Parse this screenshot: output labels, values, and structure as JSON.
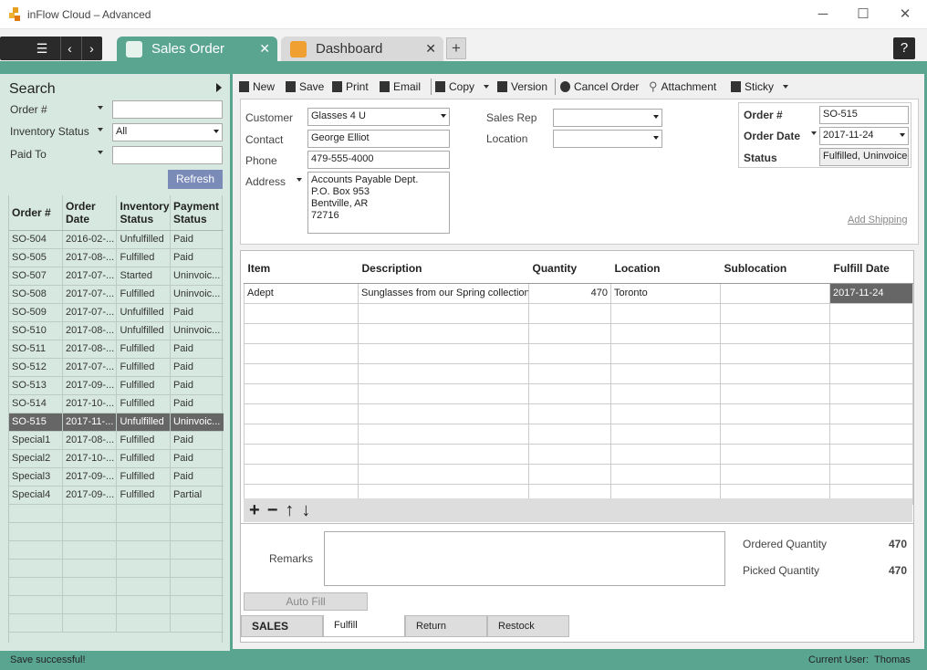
{
  "window": {
    "title": "inFlow Cloud – Advanced",
    "minimize": "─",
    "maximize": "☐",
    "close": "✕"
  },
  "nav": {
    "menu": "☰",
    "back": "‹",
    "forward": "›",
    "help": "?"
  },
  "tabs": [
    {
      "label": "Sales Order",
      "close": "✕",
      "icon": "sales-order-icon"
    },
    {
      "label": "Dashboard",
      "close": "✕",
      "icon": "dashboard-icon"
    }
  ],
  "tab_add": "+",
  "search": {
    "title": "Search",
    "fields": [
      {
        "label": "Order #",
        "value": ""
      },
      {
        "label": "Inventory Status",
        "value": "All"
      },
      {
        "label": "Paid To",
        "value": ""
      }
    ],
    "refresh": "Refresh",
    "columns": [
      "Order #",
      "Order Date",
      "Inventory Status",
      "Payment Status"
    ],
    "rows": [
      [
        "SO-504",
        "2016-02-...",
        "Unfulfilled",
        "Paid"
      ],
      [
        "SO-505",
        "2017-08-...",
        "Fulfilled",
        "Paid"
      ],
      [
        "SO-507",
        "2017-07-...",
        "Started",
        "Uninvoic..."
      ],
      [
        "SO-508",
        "2017-07-...",
        "Fulfilled",
        "Uninvoic..."
      ],
      [
        "SO-509",
        "2017-07-...",
        "Unfulfilled",
        "Paid"
      ],
      [
        "SO-510",
        "2017-08-...",
        "Unfulfilled",
        "Uninvoic..."
      ],
      [
        "SO-511",
        "2017-08-...",
        "Fulfilled",
        "Paid"
      ],
      [
        "SO-512",
        "2017-07-...",
        "Fulfilled",
        "Paid"
      ],
      [
        "SO-513",
        "2017-09-...",
        "Fulfilled",
        "Paid"
      ],
      [
        "SO-514",
        "2017-10-...",
        "Fulfilled",
        "Paid"
      ],
      [
        "SO-515",
        "2017-11-...",
        "Unfulfilled",
        "Uninvoic..."
      ],
      [
        "Special1",
        "2017-08-...",
        "Fulfilled",
        "Paid"
      ],
      [
        "Special2",
        "2017-10-...",
        "Fulfilled",
        "Paid"
      ],
      [
        "Special3",
        "2017-09-...",
        "Fulfilled",
        "Paid"
      ],
      [
        "Special4",
        "2017-09-...",
        "Fulfilled",
        "Partial"
      ]
    ],
    "selected_index": 10
  },
  "toolbar": {
    "new": "New",
    "save": "Save",
    "print": "Print",
    "email": "Email",
    "copy": "Copy",
    "version": "Version",
    "cancel": "Cancel Order",
    "attachment": "Attachment",
    "sticky": "Sticky"
  },
  "form": {
    "customer_label": "Customer",
    "customer": "Glasses 4 U",
    "contact_label": "Contact",
    "contact": "George Elliot",
    "phone_label": "Phone",
    "phone": "479-555-4000",
    "address_label": "Address",
    "address_lines": [
      "Accounts Payable Dept.",
      "P.O. Box 953",
      "Bentville, AR",
      "72716"
    ],
    "sales_rep_label": "Sales Rep",
    "sales_rep": "",
    "location_label": "Location",
    "location": "",
    "order_no_label": "Order #",
    "order_no": "SO-515",
    "order_date_label": "Order Date",
    "order_date": "2017-11-24",
    "status_label": "Status",
    "status": "Fulfilled, Uninvoiced",
    "add_shipping": "Add Shipping"
  },
  "grid": {
    "columns": [
      "Item",
      "Description",
      "Quantity",
      "Location",
      "Sublocation",
      "Fulfill Date"
    ],
    "rows": [
      [
        "Adept",
        "Sunglasses from our Spring collection.",
        "470",
        "Toronto",
        "",
        "2017-11-24"
      ]
    ],
    "tools": [
      "+",
      "−",
      "↑",
      "↓"
    ]
  },
  "remarks_label": "Remarks",
  "auto_fill": "Auto Fill",
  "totals": {
    "ordered_label": "Ordered Quantity",
    "ordered": "470",
    "picked_label": "Picked Quantity",
    "picked": "470"
  },
  "bottom_tabs": [
    "SALES",
    "Fulfill",
    "Return",
    "Restock"
  ],
  "status_bar": {
    "message": "Save successful!",
    "user_label": "Current User:",
    "user": "Thomas"
  },
  "colors": {
    "accent": "#5aa590",
    "left_bg": "#d7e8e0",
    "selected_row": "#666666",
    "refresh": "#7b8bb8"
  }
}
